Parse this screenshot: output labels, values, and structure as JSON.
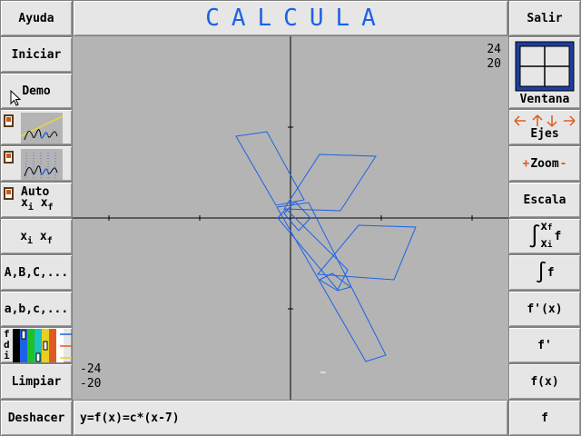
{
  "app": {
    "title": "CALCULA"
  },
  "left_panel": {
    "help": "Ayuda",
    "start": "Iniciar",
    "demo": "Demo",
    "auto_main": "Auto",
    "xi_xf_x": "x",
    "xi_xf_i": "i",
    "xi_xf_f": "f",
    "uppercase_params": "A,B,C,...",
    "lowercase_params": "a,b,c,...",
    "color_legend_labels": [
      "f",
      "d",
      "i"
    ],
    "clear": "Limpiar",
    "undo": "Deshacer"
  },
  "right_panel": {
    "exit": "Salir",
    "window": "Ventana",
    "axes": "Ejes",
    "zoom": "Zoom",
    "scale": "Escala",
    "integral_f": "f",
    "derivative": "f'(x)",
    "f_prime": "f'",
    "f_of_x": "f(x)",
    "f": "f"
  },
  "plot": {
    "y_max": "24",
    "x_max": "20",
    "y_min": "-24",
    "x_min": "-20",
    "curve_color": "#1c62e6",
    "background_color": "#b4b4b4"
  },
  "formula": {
    "text": "y=f(x)=c*(x-7)"
  },
  "colors": {
    "title": "#1c62e6",
    "arrows": "#e05a20",
    "button_bg": "#e6e6e6"
  }
}
